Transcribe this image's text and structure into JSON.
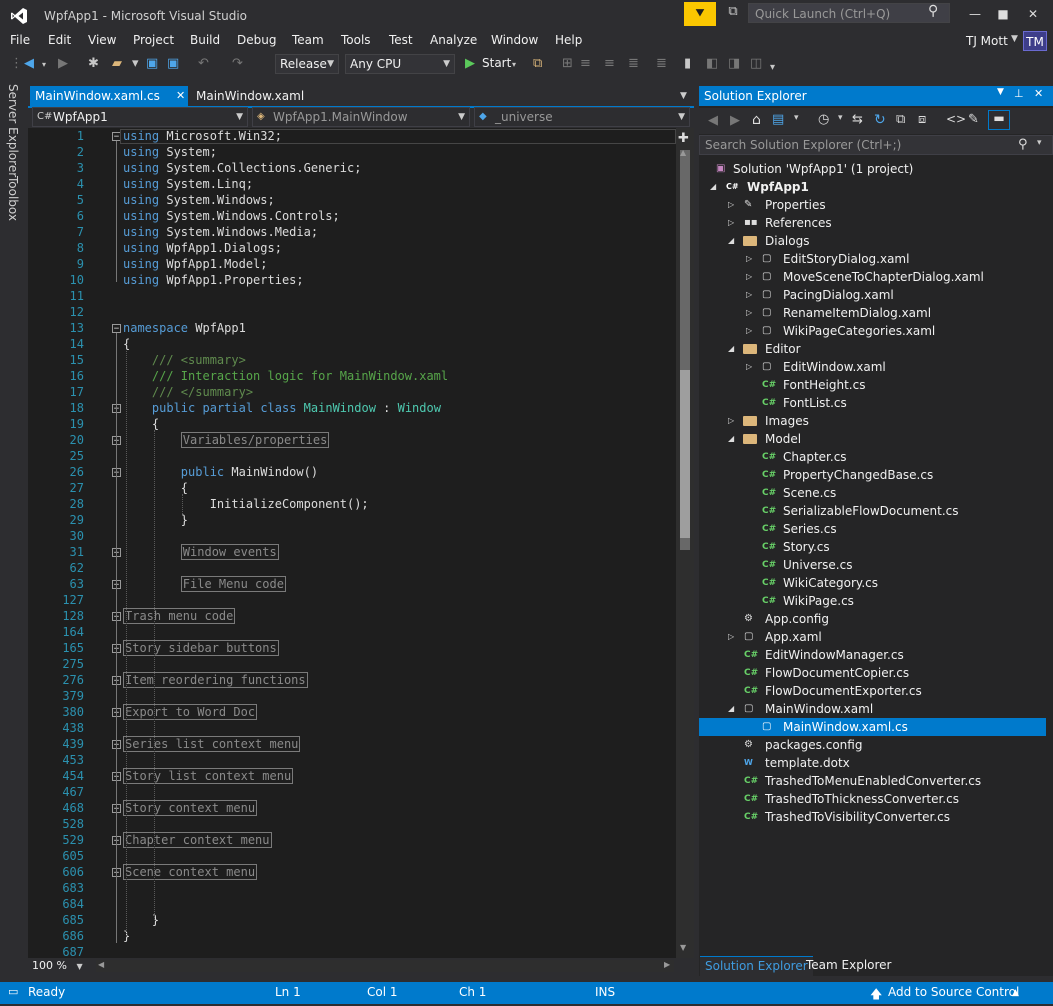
{
  "window": {
    "title": "WpfApp1 - Microsoft Visual Studio",
    "quick_launch_placeholder": "Quick Launch (Ctrl+Q)",
    "user": "TJ Mott",
    "avatar": "TM"
  },
  "menu": [
    "File",
    "Edit",
    "View",
    "Project",
    "Build",
    "Debug",
    "Team",
    "Tools",
    "Test",
    "Analyze",
    "Window",
    "Help"
  ],
  "toolbar": {
    "configuration": "Release",
    "platform": "Any CPU",
    "start_label": "Start"
  },
  "left_tabs": [
    "Server Explorer",
    "Toolbox"
  ],
  "doc_tabs": [
    {
      "label": "MainWindow.xaml.cs",
      "active": true
    },
    {
      "label": "MainWindow.xaml",
      "active": false
    }
  ],
  "nav": {
    "project": "WpfApp1",
    "type": "WpfApp1.MainWindow",
    "member": "_universe"
  },
  "editor": {
    "zoom": "100 %",
    "lines": [
      {
        "n": "1",
        "code": [
          {
            "t": "using",
            "c": "kw"
          },
          {
            "t": " Microsoft.Win32;"
          }
        ]
      },
      {
        "n": "2",
        "code": [
          {
            "t": "using",
            "c": "kw"
          },
          {
            "t": " System;"
          }
        ]
      },
      {
        "n": "3",
        "code": [
          {
            "t": "using",
            "c": "kw"
          },
          {
            "t": " System.Collections.Generic;"
          }
        ]
      },
      {
        "n": "4",
        "code": [
          {
            "t": "using",
            "c": "kw"
          },
          {
            "t": " System.Linq;"
          }
        ]
      },
      {
        "n": "5",
        "code": [
          {
            "t": "using",
            "c": "kw"
          },
          {
            "t": " System.Windows;"
          }
        ]
      },
      {
        "n": "6",
        "code": [
          {
            "t": "using",
            "c": "kw"
          },
          {
            "t": " System.Windows.Controls;"
          }
        ]
      },
      {
        "n": "7",
        "code": [
          {
            "t": "using",
            "c": "kw"
          },
          {
            "t": " System.Windows.Media;"
          }
        ]
      },
      {
        "n": "8",
        "code": [
          {
            "t": "using",
            "c": "kw"
          },
          {
            "t": " WpfApp1.Dialogs;"
          }
        ]
      },
      {
        "n": "9",
        "code": [
          {
            "t": "using",
            "c": "kw"
          },
          {
            "t": " WpfApp1.Model;"
          }
        ]
      },
      {
        "n": "10",
        "code": [
          {
            "t": "using",
            "c": "kw"
          },
          {
            "t": " WpfApp1.Properties;"
          }
        ]
      },
      {
        "n": "11",
        "code": []
      },
      {
        "n": "12",
        "code": []
      },
      {
        "n": "13",
        "code": [
          {
            "t": "namespace",
            "c": "kw"
          },
          {
            "t": " WpfApp1"
          }
        ]
      },
      {
        "n": "14",
        "code": [
          {
            "t": "{"
          }
        ]
      },
      {
        "n": "15",
        "code": [
          {
            "t": "    "
          },
          {
            "t": "/// <summary>",
            "c": "cmg"
          }
        ]
      },
      {
        "n": "16",
        "code": [
          {
            "t": "    "
          },
          {
            "t": "/// Interaction logic for MainWindow.xaml",
            "c": "cm"
          }
        ]
      },
      {
        "n": "17",
        "code": [
          {
            "t": "    "
          },
          {
            "t": "/// </summary>",
            "c": "cmg"
          }
        ]
      },
      {
        "n": "18",
        "code": [
          {
            "t": "    "
          },
          {
            "t": "public",
            "c": "kw"
          },
          {
            "t": " "
          },
          {
            "t": "partial",
            "c": "kw"
          },
          {
            "t": " "
          },
          {
            "t": "class",
            "c": "kw"
          },
          {
            "t": " "
          },
          {
            "t": "MainWindow",
            "c": "ty"
          },
          {
            "t": " : "
          },
          {
            "t": "Window",
            "c": "ty"
          }
        ]
      },
      {
        "n": "19",
        "code": [
          {
            "t": "    {"
          }
        ]
      },
      {
        "n": "20",
        "code": [
          {
            "t": "        "
          },
          {
            "t": "Variables/properties",
            "c": "collapsed"
          }
        ]
      },
      {
        "n": "25",
        "code": []
      },
      {
        "n": "26",
        "code": [
          {
            "t": "        "
          },
          {
            "t": "public",
            "c": "kw"
          },
          {
            "t": " MainWindow()"
          }
        ]
      },
      {
        "n": "27",
        "code": [
          {
            "t": "        {"
          }
        ]
      },
      {
        "n": "28",
        "code": [
          {
            "t": "            InitializeComponent();"
          }
        ]
      },
      {
        "n": "29",
        "code": [
          {
            "t": "        }"
          }
        ]
      },
      {
        "n": "30",
        "code": []
      },
      {
        "n": "31",
        "code": [
          {
            "t": "        "
          },
          {
            "t": "Window events",
            "c": "collapsed"
          }
        ]
      },
      {
        "n": "62",
        "code": []
      },
      {
        "n": "63",
        "code": [
          {
            "t": "        "
          },
          {
            "t": "File Menu code",
            "c": "collapsed"
          }
        ]
      },
      {
        "n": "127",
        "code": []
      },
      {
        "n": "128",
        "code": [
          {
            "t": "Trash menu code",
            "c": "collapsed"
          }
        ]
      },
      {
        "n": "164",
        "code": []
      },
      {
        "n": "165",
        "code": [
          {
            "t": "Story sidebar buttons",
            "c": "collapsed"
          }
        ]
      },
      {
        "n": "275",
        "code": []
      },
      {
        "n": "276",
        "code": [
          {
            "t": "Item reordering functions",
            "c": "collapsed"
          }
        ]
      },
      {
        "n": "379",
        "code": []
      },
      {
        "n": "380",
        "code": [
          {
            "t": "Export to Word Doc",
            "c": "collapsed"
          }
        ]
      },
      {
        "n": "438",
        "code": []
      },
      {
        "n": "439",
        "code": [
          {
            "t": "Series list context menu",
            "c": "collapsed"
          }
        ]
      },
      {
        "n": "453",
        "code": []
      },
      {
        "n": "454",
        "code": [
          {
            "t": "Story list context menu",
            "c": "collapsed"
          }
        ]
      },
      {
        "n": "467",
        "code": []
      },
      {
        "n": "468",
        "code": [
          {
            "t": "Story context menu",
            "c": "collapsed"
          }
        ]
      },
      {
        "n": "528",
        "code": []
      },
      {
        "n": "529",
        "code": [
          {
            "t": "Chapter context menu",
            "c": "collapsed"
          }
        ]
      },
      {
        "n": "605",
        "code": []
      },
      {
        "n": "606",
        "code": [
          {
            "t": "Scene context menu",
            "c": "collapsed"
          }
        ]
      },
      {
        "n": "683",
        "code": []
      },
      {
        "n": "684",
        "code": []
      },
      {
        "n": "685",
        "code": [
          {
            "t": "    }"
          }
        ]
      },
      {
        "n": "686",
        "code": [
          {
            "t": "}"
          }
        ]
      },
      {
        "n": "687",
        "code": []
      }
    ]
  },
  "solution_explorer": {
    "title": "Solution Explorer",
    "search_placeholder": "Search Solution Explorer (Ctrl+;)",
    "items": [
      {
        "label": "Solution 'WpfApp1' (1 project)",
        "depth": 0,
        "tri": "",
        "icon": "solution-icon"
      },
      {
        "label": "WpfApp1",
        "depth": 0,
        "tri": "open",
        "icon": "csproj-icon",
        "bold": true
      },
      {
        "label": "Properties",
        "depth": 1,
        "tri": "closed",
        "icon": "wrench-icon"
      },
      {
        "label": "References",
        "depth": 1,
        "tri": "closed",
        "icon": "references-icon"
      },
      {
        "label": "Dialogs",
        "depth": 1,
        "tri": "open",
        "icon": "folder-icon"
      },
      {
        "label": "EditStoryDialog.xaml",
        "depth": 2,
        "tri": "closed",
        "icon": "xaml-icon"
      },
      {
        "label": "MoveSceneToChapterDialog.xaml",
        "depth": 2,
        "tri": "closed",
        "icon": "xaml-icon"
      },
      {
        "label": "PacingDialog.xaml",
        "depth": 2,
        "tri": "closed",
        "icon": "xaml-icon"
      },
      {
        "label": "RenameItemDialog.xaml",
        "depth": 2,
        "tri": "closed",
        "icon": "xaml-icon"
      },
      {
        "label": "WikiPageCategories.xaml",
        "depth": 2,
        "tri": "closed",
        "icon": "xaml-icon"
      },
      {
        "label": "Editor",
        "depth": 1,
        "tri": "open",
        "icon": "folder-icon"
      },
      {
        "label": "EditWindow.xaml",
        "depth": 2,
        "tri": "closed",
        "icon": "xaml-icon"
      },
      {
        "label": "FontHeight.cs",
        "depth": 2,
        "tri": "",
        "icon": "cs-icon"
      },
      {
        "label": "FontList.cs",
        "depth": 2,
        "tri": "",
        "icon": "cs-icon"
      },
      {
        "label": "Images",
        "depth": 1,
        "tri": "closed",
        "icon": "folder-icon"
      },
      {
        "label": "Model",
        "depth": 1,
        "tri": "open",
        "icon": "folder-icon"
      },
      {
        "label": "Chapter.cs",
        "depth": 2,
        "tri": "",
        "icon": "cs-icon"
      },
      {
        "label": "PropertyChangedBase.cs",
        "depth": 2,
        "tri": "",
        "icon": "cs-icon"
      },
      {
        "label": "Scene.cs",
        "depth": 2,
        "tri": "",
        "icon": "cs-icon"
      },
      {
        "label": "SerializableFlowDocument.cs",
        "depth": 2,
        "tri": "",
        "icon": "cs-icon"
      },
      {
        "label": "Series.cs",
        "depth": 2,
        "tri": "",
        "icon": "cs-icon"
      },
      {
        "label": "Story.cs",
        "depth": 2,
        "tri": "",
        "icon": "cs-icon"
      },
      {
        "label": "Universe.cs",
        "depth": 2,
        "tri": "",
        "icon": "cs-icon"
      },
      {
        "label": "WikiCategory.cs",
        "depth": 2,
        "tri": "",
        "icon": "cs-icon"
      },
      {
        "label": "WikiPage.cs",
        "depth": 2,
        "tri": "",
        "icon": "cs-icon"
      },
      {
        "label": "App.config",
        "depth": 1,
        "tri": "",
        "icon": "config-icon"
      },
      {
        "label": "App.xaml",
        "depth": 1,
        "tri": "closed",
        "icon": "xaml-icon"
      },
      {
        "label": "EditWindowManager.cs",
        "depth": 1,
        "tri": "",
        "icon": "cs-icon"
      },
      {
        "label": "FlowDocumentCopier.cs",
        "depth": 1,
        "tri": "",
        "icon": "cs-icon"
      },
      {
        "label": "FlowDocumentExporter.cs",
        "depth": 1,
        "tri": "",
        "icon": "cs-icon"
      },
      {
        "label": "MainWindow.xaml",
        "depth": 1,
        "tri": "open",
        "icon": "xaml-icon"
      },
      {
        "label": "MainWindow.xaml.cs",
        "depth": 2,
        "tri": "",
        "icon": "cs-file-icon",
        "selected": true
      },
      {
        "label": "packages.config",
        "depth": 1,
        "tri": "",
        "icon": "config-icon"
      },
      {
        "label": "template.dotx",
        "depth": 1,
        "tri": "",
        "icon": "word-icon"
      },
      {
        "label": "TrashedToMenuEnabledConverter.cs",
        "depth": 1,
        "tri": "",
        "icon": "cs-icon"
      },
      {
        "label": "TrashedToThicknessConverter.cs",
        "depth": 1,
        "tri": "",
        "icon": "cs-icon"
      },
      {
        "label": "TrashedToVisibilityConverter.cs",
        "depth": 1,
        "tri": "",
        "icon": "cs-icon"
      }
    ],
    "bottom_tabs": [
      "Solution Explorer",
      "Team Explorer"
    ]
  },
  "status": {
    "ready": "Ready",
    "ln": "Ln 1",
    "col": "Col 1",
    "ch": "Ch 1",
    "ins": "INS",
    "source_control": "Add to Source Control"
  }
}
